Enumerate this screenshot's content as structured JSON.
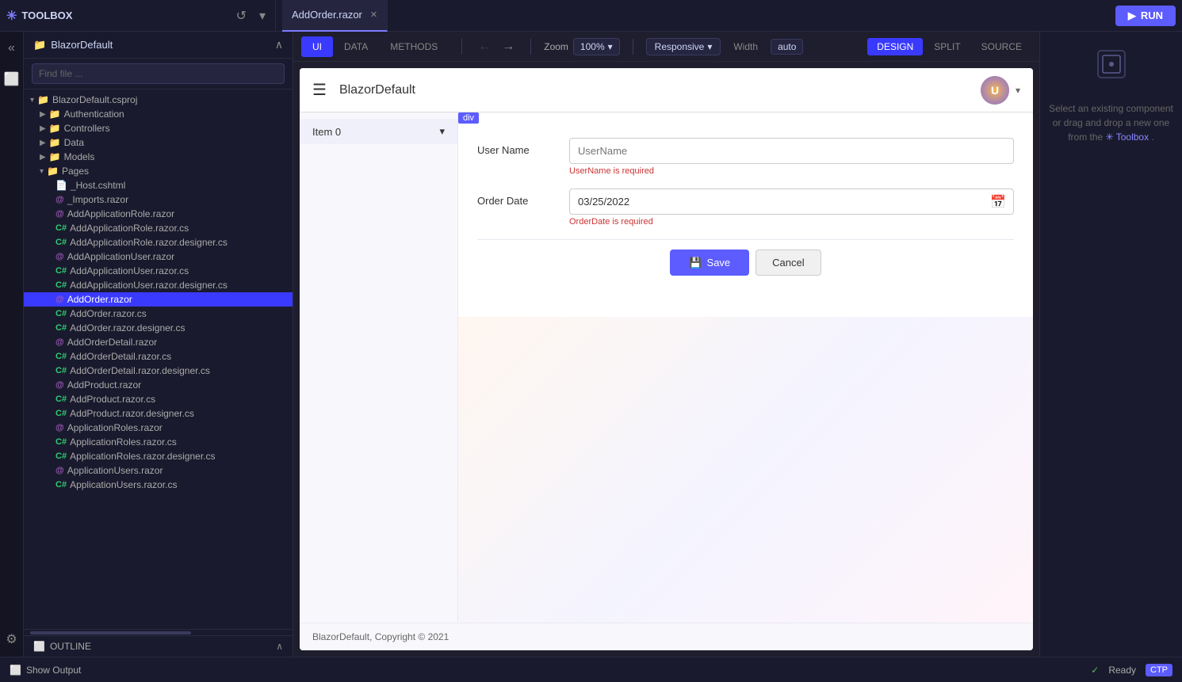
{
  "topbar": {
    "toolbox_label": "TOOLBOX",
    "tab_active": "AddOrder.razor",
    "run_label": "RUN"
  },
  "sidebar": {
    "title": "BlazorDefault",
    "search_placeholder": "Find file ...",
    "tree": [
      {
        "id": "blazordefault-csproj",
        "label": "BlazorDefault.csproj",
        "type": "folder",
        "level": 0,
        "expanded": true
      },
      {
        "id": "authentication",
        "label": "Authentication",
        "type": "folder",
        "level": 1,
        "expanded": false
      },
      {
        "id": "controllers",
        "label": "Controllers",
        "type": "folder",
        "level": 1,
        "expanded": false
      },
      {
        "id": "data",
        "label": "Data",
        "type": "folder",
        "level": 1,
        "expanded": false
      },
      {
        "id": "models",
        "label": "Models",
        "type": "folder",
        "level": 1,
        "expanded": false
      },
      {
        "id": "pages",
        "label": "Pages",
        "type": "folder",
        "level": 1,
        "expanded": true
      },
      {
        "id": "_host",
        "label": "_Host.cshtml",
        "type": "cshtml",
        "level": 2
      },
      {
        "id": "_imports",
        "label": "_Imports.razor",
        "type": "razor",
        "level": 2
      },
      {
        "id": "addapplicationrole",
        "label": "AddApplicationRole.razor",
        "type": "razor",
        "level": 2
      },
      {
        "id": "addapplicationrole-cs",
        "label": "AddApplicationRole.razor.cs",
        "type": "cs",
        "level": 2
      },
      {
        "id": "addapplicationrole-designer",
        "label": "AddApplicationRole.razor.designer.cs",
        "type": "cs",
        "level": 2
      },
      {
        "id": "addapplicationuser",
        "label": "AddApplicationUser.razor",
        "type": "razor",
        "level": 2
      },
      {
        "id": "addapplicationuser-cs",
        "label": "AddApplicationUser.razor.cs",
        "type": "cs",
        "level": 2
      },
      {
        "id": "addapplicationuser-designer",
        "label": "AddApplicationUser.razor.designer.cs",
        "type": "cs",
        "level": 2
      },
      {
        "id": "addorder",
        "label": "AddOrder.razor",
        "type": "razor",
        "level": 2,
        "active": true
      },
      {
        "id": "addorder-cs",
        "label": "AddOrder.razor.cs",
        "type": "cs",
        "level": 2
      },
      {
        "id": "addorder-designer",
        "label": "AddOrder.razor.designer.cs",
        "type": "cs",
        "level": 2
      },
      {
        "id": "addorderdetail",
        "label": "AddOrderDetail.razor",
        "type": "razor",
        "level": 2
      },
      {
        "id": "addorderdetail-cs",
        "label": "AddOrderDetail.razor.cs",
        "type": "cs",
        "level": 2
      },
      {
        "id": "addorderdetail-designer",
        "label": "AddOrderDetail.razor.designer.cs",
        "type": "cs",
        "level": 2
      },
      {
        "id": "addproduct",
        "label": "AddProduct.razor",
        "type": "razor",
        "level": 2
      },
      {
        "id": "addproduct-cs",
        "label": "AddProduct.razor.cs",
        "type": "cs",
        "level": 2
      },
      {
        "id": "addproduct-designer",
        "label": "AddProduct.razor.designer.cs",
        "type": "cs",
        "level": 2
      },
      {
        "id": "applicationroles",
        "label": "ApplicationRoles.razor",
        "type": "razor",
        "level": 2
      },
      {
        "id": "applicationroles-cs",
        "label": "ApplicationRoles.razor.cs",
        "type": "cs",
        "level": 2
      },
      {
        "id": "applicationroles-designer",
        "label": "ApplicationRoles.razor.designer.cs",
        "type": "cs",
        "level": 2
      },
      {
        "id": "applicationusers",
        "label": "ApplicationUsers.razor",
        "type": "razor",
        "level": 2
      },
      {
        "id": "applicationusers-cs",
        "label": "ApplicationUsers.razor.cs",
        "type": "cs",
        "level": 2
      }
    ],
    "outline_label": "OUTLINE"
  },
  "editor": {
    "tabs": [
      "UI",
      "DATA",
      "METHODS"
    ],
    "active_tab": "UI",
    "zoom_label": "Zoom",
    "zoom_value": "100%",
    "responsive_label": "Responsive",
    "width_label": "Width",
    "width_value": "auto",
    "view_modes": [
      "DESIGN",
      "SPLIT",
      "SOURCE"
    ],
    "active_view": "DESIGN"
  },
  "preview": {
    "app_title": "BlazorDefault",
    "nav_item": "Item 0",
    "div_badge": "div",
    "form": {
      "username_label": "User Name",
      "username_placeholder": "UserName",
      "username_error": "UserName is required",
      "orderdate_label": "Order Date",
      "orderdate_value": "03/25/2022",
      "orderdate_error": "OrderDate is required",
      "save_label": "Save",
      "cancel_label": "Cancel"
    },
    "footer": "BlazorDefault, Copyright © 2021"
  },
  "right_panel": {
    "info_text": "Select an existing component or drag and drop a new one from the",
    "toolbox_link": "✳ Toolbox",
    "period": "."
  },
  "bottom_bar": {
    "show_output": "Show Output",
    "ready": "Ready",
    "ctp": "CTP"
  }
}
